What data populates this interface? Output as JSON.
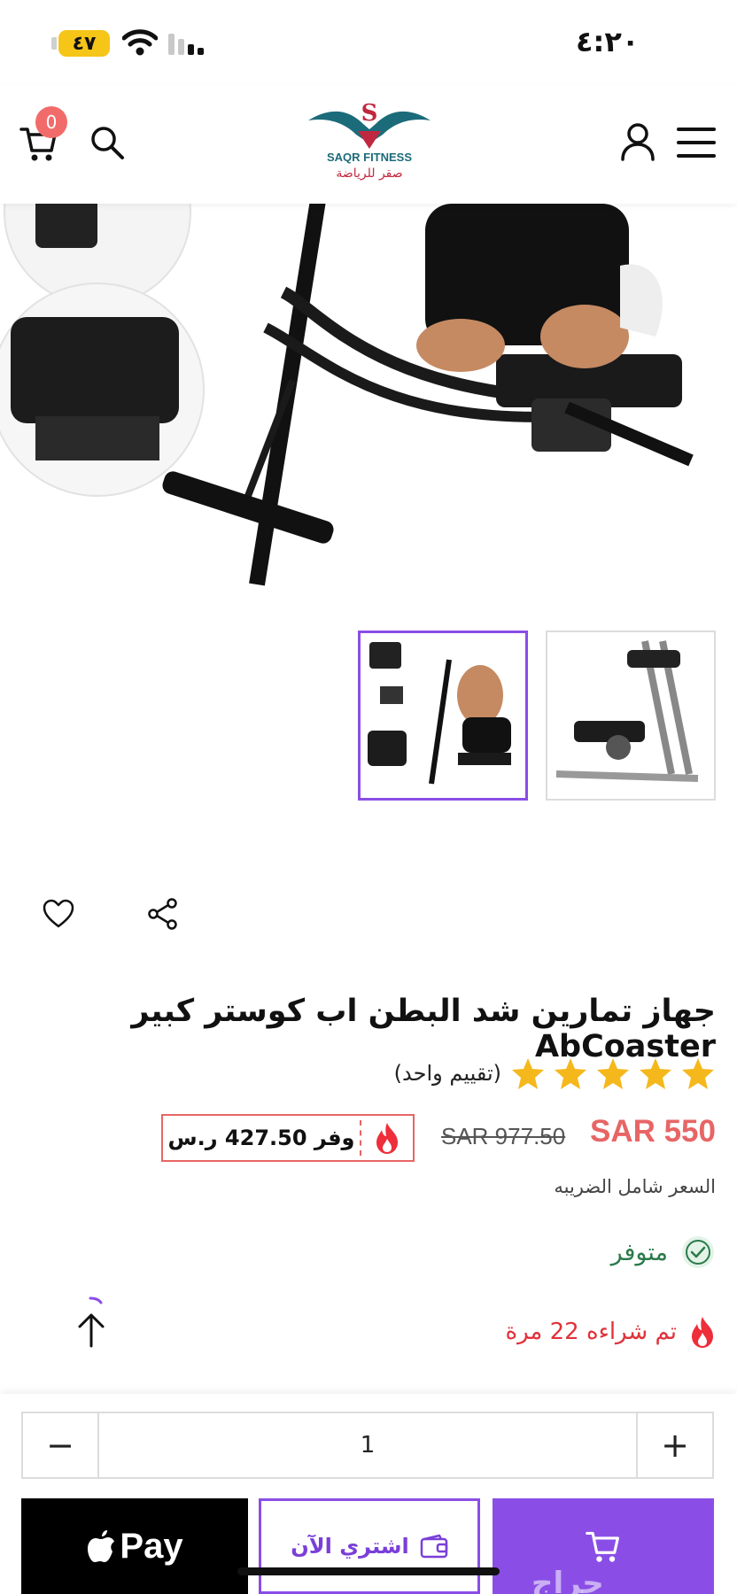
{
  "status_bar": {
    "time": "٤:٢٠",
    "battery": "٤٧"
  },
  "header": {
    "cart_count": "0",
    "logo_text_en": "SAQR FITNESS",
    "logo_text_ar": "صقر للرياضة",
    "icons": [
      "cart-icon",
      "search-icon",
      "user-icon",
      "menu-icon"
    ]
  },
  "product": {
    "title": "جهاز تمارين شد البطن اب كوستر كبير AbCoaster",
    "rating_stars": 5,
    "rating_text": "(تقييم واحد)",
    "price": "SAR 550",
    "old_price": "SAR 977.50",
    "save_text": "وفر 427.50 ر.س",
    "tax_note": "السعر شامل الضريبه",
    "stock_text": "متوفر",
    "sold_text": "تم شراءه 22 مرة",
    "thumbnail_count": 2,
    "active_thumbnail": 1
  },
  "purchase": {
    "quantity": "1",
    "minus_label": "−",
    "plus_label": "+",
    "apple_pay_label": "Pay",
    "buy_now_label": "اشتري الآن",
    "watermark": "حراج"
  },
  "colors": {
    "accent": "#8a4ee6",
    "price": "#e86565",
    "stock": "#2b7a4b",
    "sold": "#e0323a",
    "star": "#f5b81c",
    "battery": "#f5c518"
  }
}
